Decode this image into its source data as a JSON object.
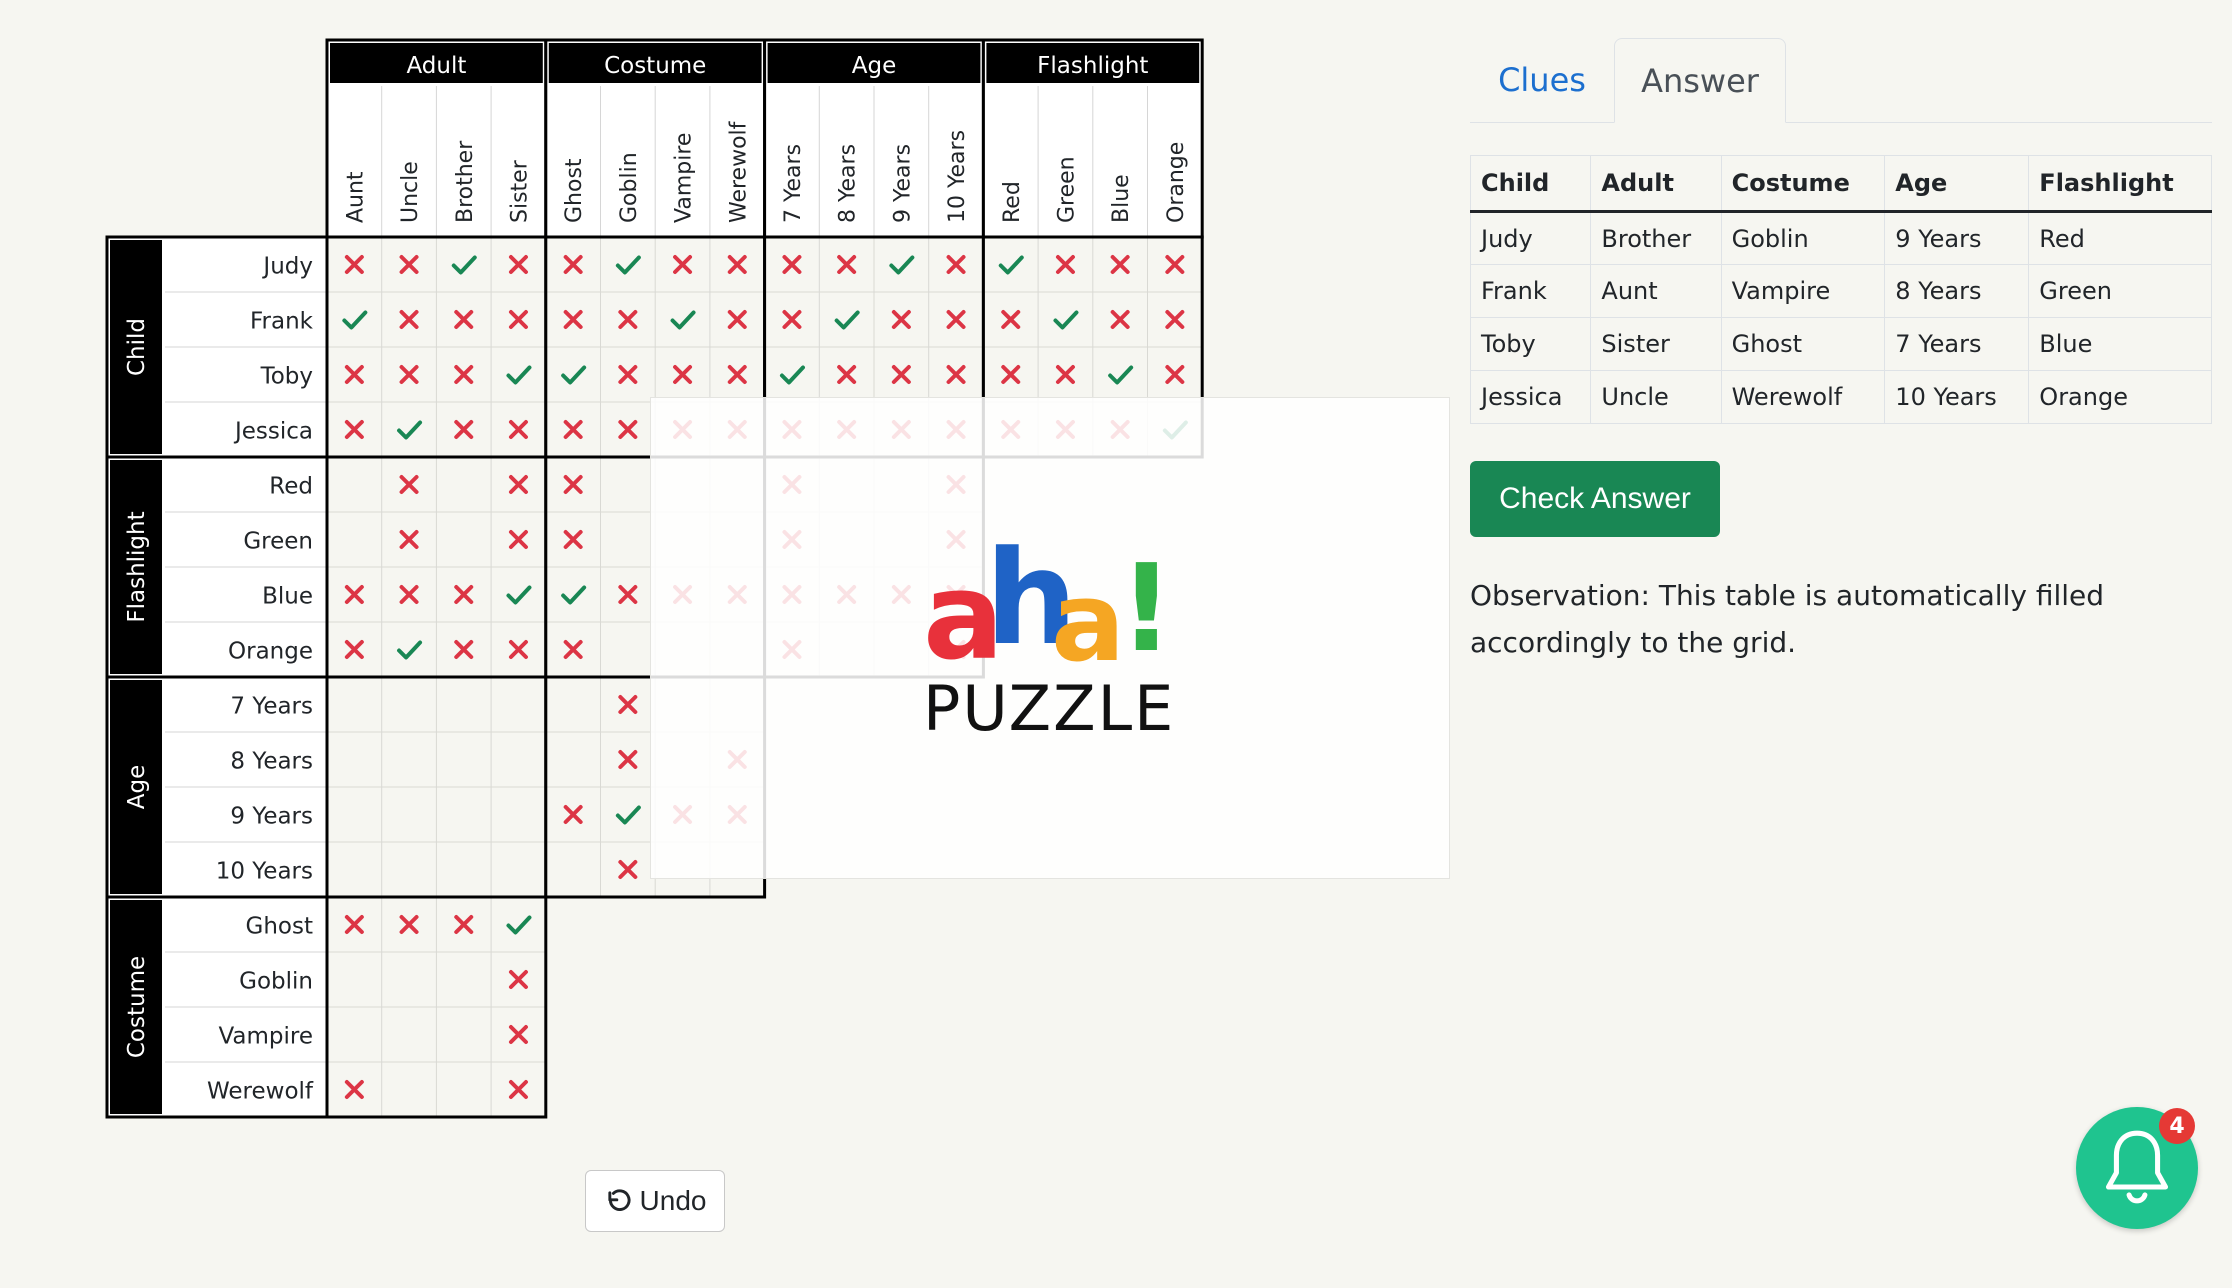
{
  "grid": {
    "top_groups": [
      {
        "label": "Adult",
        "items": [
          "Aunt",
          "Uncle",
          "Brother",
          "Sister"
        ]
      },
      {
        "label": "Costume",
        "items": [
          "Ghost",
          "Goblin",
          "Vampire",
          "Werewolf"
        ]
      },
      {
        "label": "Age",
        "items": [
          "7 Years",
          "8 Years",
          "9 Years",
          "10 Years"
        ]
      },
      {
        "label": "Flashlight",
        "items": [
          "Red",
          "Green",
          "Blue",
          "Orange"
        ]
      }
    ],
    "left_groups": [
      {
        "label": "Child",
        "items": [
          "Judy",
          "Frank",
          "Toby",
          "Jessica"
        ]
      },
      {
        "label": "Flashlight",
        "items": [
          "Red",
          "Green",
          "Blue",
          "Orange"
        ]
      },
      {
        "label": "Age",
        "items": [
          "7 Years",
          "8 Years",
          "9 Years",
          "10 Years"
        ]
      },
      {
        "label": "Costume",
        "items": [
          "Ghost",
          "Goblin",
          "Vampire",
          "Werewolf"
        ]
      }
    ],
    "blocks": [
      [
        [
          "XXVX",
          "VXXX",
          "XXXV",
          "XVXX"
        ],
        [
          "XVXX",
          "XXVX",
          "VXXX",
          "XXXX"
        ],
        [
          "XXVX",
          "XVXX",
          "VXXX",
          "XXXX"
        ],
        [
          "VXXX",
          "XVXX",
          "XXVX",
          "XXXV"
        ]
      ],
      [
        [
          ".X.X",
          ".X.X",
          "XXXV",
          "XVXX"
        ],
        [
          "X...",
          "X...",
          "VXXX",
          "X..."
        ],
        [
          "X..X",
          "X..X",
          "XXXX",
          "X..X"
        ]
      ],
      [
        [
          "....",
          "....",
          "....",
          "...."
        ],
        [
          ".X..",
          ".X.X",
          "XVXX",
          ".X.."
        ]
      ],
      [
        [
          "XXXV",
          "...X",
          "...X",
          "X..X"
        ]
      ]
    ]
  },
  "logo": {
    "text_main": "aha!",
    "text_sub": "PUZZLES"
  },
  "undo_label": "Undo",
  "tabs": {
    "clues": "Clues",
    "answer": "Answer"
  },
  "answer_table": {
    "headers": [
      "Child",
      "Adult",
      "Costume",
      "Age",
      "Flashlight"
    ],
    "rows": [
      [
        "Judy",
        "Brother",
        "Goblin",
        "9 Years",
        "Red"
      ],
      [
        "Frank",
        "Aunt",
        "Vampire",
        "8 Years",
        "Green"
      ],
      [
        "Toby",
        "Sister",
        "Ghost",
        "7 Years",
        "Blue"
      ],
      [
        "Jessica",
        "Uncle",
        "Werewolf",
        "10 Years",
        "Orange"
      ]
    ]
  },
  "check_answer_label": "Check Answer",
  "observation": "Observation: This table is automatically filled accordingly to the grid.",
  "notification": {
    "count": "4",
    "icon": "bell-icon"
  },
  "colors": {
    "cross": "#dc3545",
    "check": "#198754",
    "button": "#198754",
    "notify": "#1fc48f",
    "link": "#1c6fcf"
  }
}
